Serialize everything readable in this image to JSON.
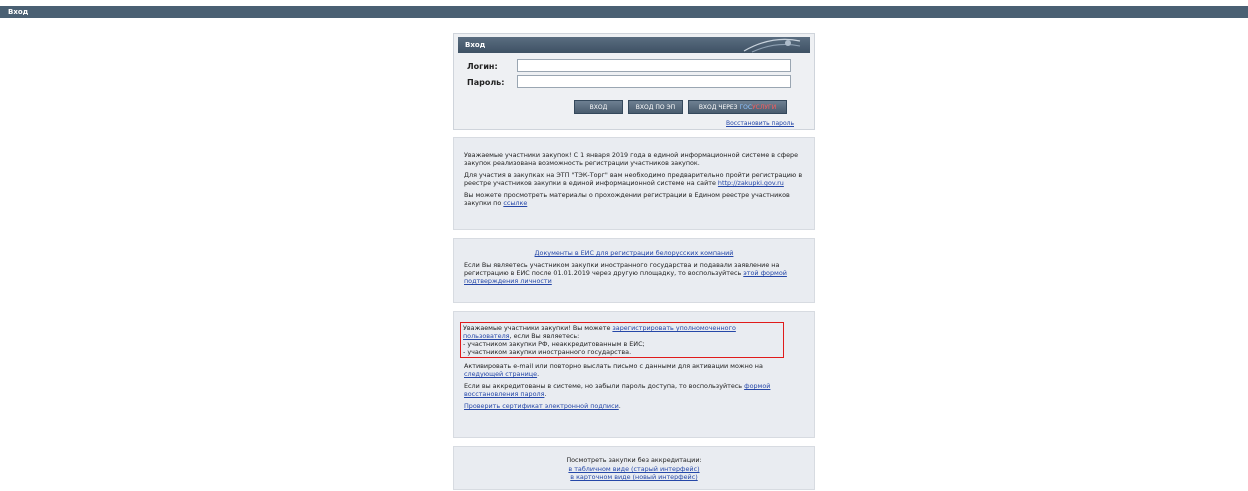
{
  "window": {
    "title": "Вход"
  },
  "login": {
    "header": "Вход",
    "login_label": "Логин:",
    "password_label": "Пароль:",
    "login_value": "",
    "password_value": "",
    "buttons": {
      "enter": "ВХОД",
      "enter_ep": "ВХОД ПО ЭП",
      "enter_gos_prefix": "ВХОД ЧЕРЕЗ ",
      "gos_part1": "ГОС",
      "gos_part2": "УСЛУГИ"
    },
    "restore_link": "Восстановить пароль"
  },
  "box1": {
    "p1": "Уважаемые участники закупок! С 1 января 2019 года в единой информационной системе в сфере закупок реализована возможность регистрации участников закупок.",
    "p2": "Для участия в закупках на ЭТП \"ТЭК-Торг\" вам необходимо предварительно пройти регистрацию в реестре участников закупки в единой информационной системе на сайте ",
    "p2_link": "http://zakupki.gov.ru",
    "p3": "Вы можете просмотреть материалы о прохождении регистрации в Едином реестре участников закупки по ",
    "p3_link": "ссылке"
  },
  "box2": {
    "link_title": "Документы в ЕИС для регистрации белорусских компаний",
    "p1": "Если Вы являетесь участником закупки иностранного государства и подавали заявление на регистрацию в ЕИС после 01.01.2019 через другую площадку, то воспользуйтесь ",
    "p1_link": "этой формой подтверждения личности"
  },
  "box3": {
    "hl_text": "Уважаемые участники закупки! Вы можете ",
    "hl_link": "зарегистрировать уполномоченного пользователя",
    "hl_after": ", если Вы являетесь:",
    "hl_item1": "- участником закупки РФ, неаккредитованным в ЕИС;",
    "hl_item2": "- участником закупки иностранного государства.",
    "p2": "Активировать e-mail или повторно выслать письмо с данными для активации можно на ",
    "p2_link": "следующей странице",
    "p2_end": ".",
    "p3": "Если вы аккредитованы в системе, но забыли пароль доступа, то воспользуйтесь ",
    "p3_link": "формой восстановления пароля",
    "p3_end": ".",
    "p4_link": "Проверить сертификат электронной подписи",
    "p4_end": "."
  },
  "box4": {
    "title": "Посмотреть закупки без аккредитации:",
    "link1": "в табличном виде (старый интерфейс)",
    "link2": "в карточном виде (новый интерфейс)"
  },
  "colors": {
    "title_bar": "#4a6073",
    "panel": "#e9ecf1",
    "link": "#2547a8",
    "highlight_border": "#e01b1b"
  }
}
